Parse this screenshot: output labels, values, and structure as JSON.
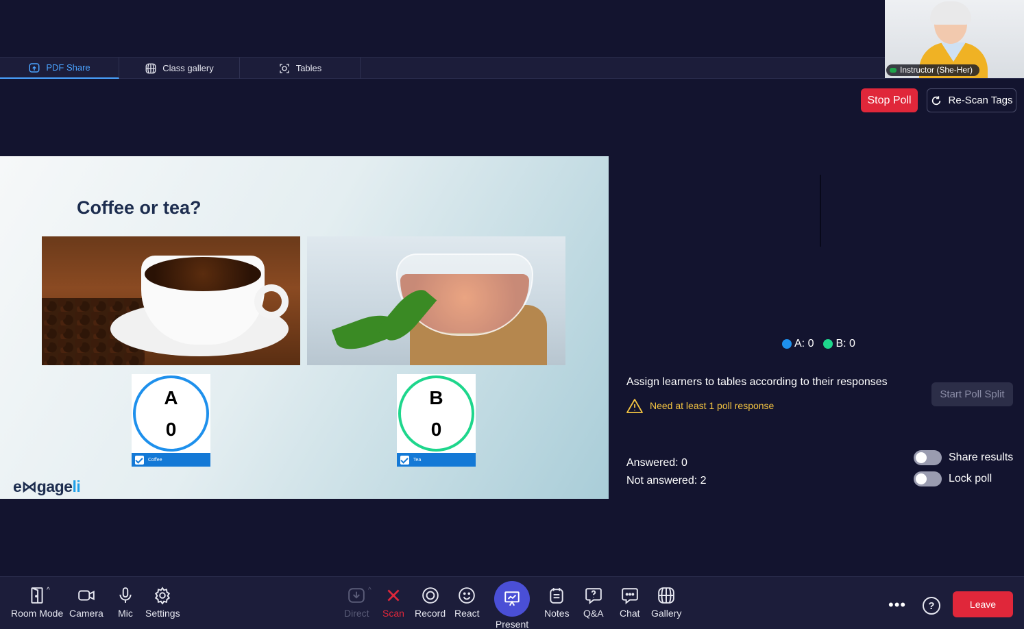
{
  "tabs": [
    {
      "label": "PDF Share",
      "icon": "share-screen-icon",
      "active": true
    },
    {
      "label": "Class gallery",
      "icon": "globe-icon",
      "active": false
    },
    {
      "label": "Tables",
      "icon": "expand-frame-icon",
      "active": false
    }
  ],
  "video": {
    "name": "Instructor (She-Her)"
  },
  "actions": {
    "stop_poll": "Stop Poll",
    "rescan": "Re-Scan Tags"
  },
  "slide": {
    "title": "Coffee or tea?",
    "options": [
      {
        "letter": "A",
        "count": "0",
        "label": "Coffee",
        "color": "#1e90ec"
      },
      {
        "letter": "B",
        "count": "0",
        "label": "Tea",
        "color": "#1ed68c"
      }
    ],
    "logo_a": "e",
    "logo_b": "⋈",
    "logo_c": "gage",
    "logo_d": "li"
  },
  "poll": {
    "legend": [
      {
        "label": "A: 0",
        "color": "#1e90ec"
      },
      {
        "label": "B: 0",
        "color": "#1ed68c"
      }
    ],
    "assign_text": "Assign learners to tables according to their responses",
    "warning": "Need at least 1 poll response",
    "start_split": "Start Poll Split",
    "answered": "Answered: 0",
    "not_answered": "Not answered: 2",
    "share_results": "Share results",
    "lock_poll": "Lock poll"
  },
  "toolbar": {
    "room_mode": "Room Mode",
    "camera": "Camera",
    "mic": "Mic",
    "settings": "Settings",
    "direct": "Direct",
    "scan": "Scan",
    "record": "Record",
    "react": "React",
    "present": "Present",
    "notes": "Notes",
    "qa": "Q&A",
    "chat": "Chat",
    "gallery": "Gallery",
    "leave": "Leave",
    "more": "•••",
    "help": "?"
  }
}
